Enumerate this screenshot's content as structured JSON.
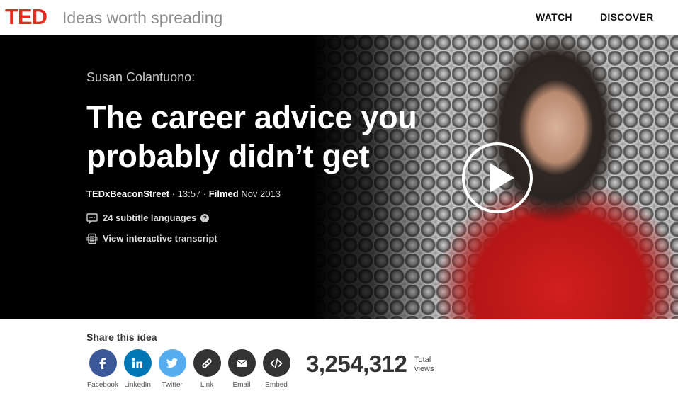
{
  "header": {
    "logo": "TED",
    "tagline": "Ideas worth spreading",
    "nav": [
      {
        "label": "WATCH"
      },
      {
        "label": "DISCOVER"
      }
    ]
  },
  "talk": {
    "speaker": "Susan Colantuono:",
    "title": "The career advice you probably didn’t get",
    "event": "TEDxBeaconStreet",
    "separator": "·",
    "duration": "13:57",
    "filmed_label": "Filmed",
    "filmed_date": "Nov 2013",
    "subtitles": "24 subtitle languages",
    "help": "?",
    "transcript": "View interactive transcript"
  },
  "share": {
    "heading": "Share this idea",
    "buttons": [
      {
        "label": "Facebook",
        "icon": "facebook-icon",
        "color": "#3b5998"
      },
      {
        "label": "LinkedIn",
        "icon": "linkedin-icon",
        "color": "#0077b5"
      },
      {
        "label": "Twitter",
        "icon": "twitter-icon",
        "color": "#55acee"
      },
      {
        "label": "Link",
        "icon": "link-icon",
        "color": "#333333"
      },
      {
        "label": "Email",
        "icon": "email-icon",
        "color": "#333333"
      },
      {
        "label": "Embed",
        "icon": "embed-icon",
        "color": "#333333"
      }
    ],
    "views_count": "3,254,312",
    "views_label_1": "Total",
    "views_label_2": "views"
  },
  "colors": {
    "brand": "#e62b1e"
  }
}
